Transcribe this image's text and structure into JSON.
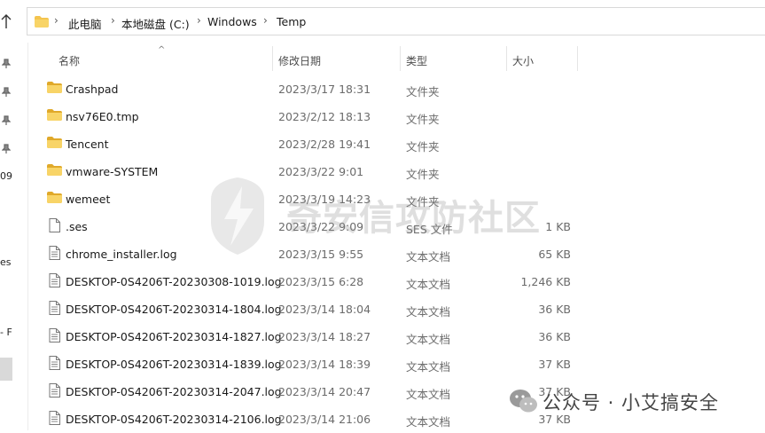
{
  "address": {
    "crumbs": [
      "此电脑",
      "本地磁盘 (C:)",
      "Windows",
      "Temp"
    ]
  },
  "nav": {
    "fragments": [
      "09",
      "es",
      "- F"
    ]
  },
  "columns": {
    "name": "名称",
    "date": "修改日期",
    "type": "类型",
    "size": "大小"
  },
  "files": [
    {
      "name": "Crashpad",
      "date": "2023/3/17 18:31",
      "type": "文件夹",
      "size": "",
      "kind": "folder"
    },
    {
      "name": "nsv76E0.tmp",
      "date": "2023/2/12 18:13",
      "type": "文件夹",
      "size": "",
      "kind": "folder"
    },
    {
      "name": "Tencent",
      "date": "2023/2/28 19:41",
      "type": "文件夹",
      "size": "",
      "kind": "folder"
    },
    {
      "name": "vmware-SYSTEM",
      "date": "2023/3/22 9:01",
      "type": "文件夹",
      "size": "",
      "kind": "folder"
    },
    {
      "name": "wemeet",
      "date": "2023/3/19 14:23",
      "type": "文件夹",
      "size": "",
      "kind": "folder"
    },
    {
      "name": ".ses",
      "date": "2023/3/22 9:09",
      "type": "SES 文件",
      "size": "1 KB",
      "kind": "file"
    },
    {
      "name": "chrome_installer.log",
      "date": "2023/3/15 9:55",
      "type": "文本文档",
      "size": "65 KB",
      "kind": "text"
    },
    {
      "name": "DESKTOP-0S4206T-20230308-1019.log",
      "date": "2023/3/15 6:28",
      "type": "文本文档",
      "size": "1,246 KB",
      "kind": "text"
    },
    {
      "name": "DESKTOP-0S4206T-20230314-1804.log",
      "date": "2023/3/14 18:04",
      "type": "文本文档",
      "size": "36 KB",
      "kind": "text"
    },
    {
      "name": "DESKTOP-0S4206T-20230314-1827.log",
      "date": "2023/3/14 18:27",
      "type": "文本文档",
      "size": "36 KB",
      "kind": "text"
    },
    {
      "name": "DESKTOP-0S4206T-20230314-1839.log",
      "date": "2023/3/14 18:39",
      "type": "文本文档",
      "size": "37 KB",
      "kind": "text"
    },
    {
      "name": "DESKTOP-0S4206T-20230314-2047.log",
      "date": "2023/3/14 20:47",
      "type": "文本文档",
      "size": "37 KB",
      "kind": "text"
    },
    {
      "name": "DESKTOP-0S4206T-20230314-2106.log",
      "date": "2023/3/14 21:06",
      "type": "文本文档",
      "size": "37 KB",
      "kind": "text"
    }
  ],
  "watermark": {
    "text": "奇安信攻防社区"
  },
  "brand": {
    "text": "公众号 · 小艾搞安全"
  },
  "colors": {
    "folder": "#f4c44e",
    "folder_dark": "#e0a92a",
    "header_text": "#4d4d4d",
    "meta_text": "#6b6b6b"
  }
}
